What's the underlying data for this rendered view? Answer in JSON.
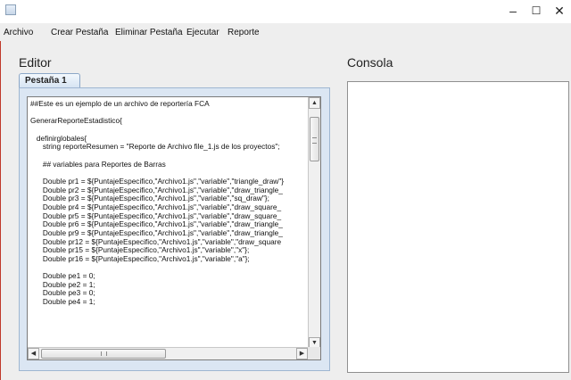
{
  "window": {
    "minimize_glyph": "–",
    "maximize_glyph": "☐",
    "close_glyph": "✕"
  },
  "menu": {
    "items": [
      "Archivo",
      "Crear Pestaña",
      "Eliminar Pestaña",
      "Ejecutar",
      "Reporte"
    ]
  },
  "editor": {
    "title": "Editor",
    "tabs": [
      {
        "label": "Pestaña 1",
        "selected": true
      }
    ],
    "lines": [
      "##Este es un ejemplo de un archivo de reportería FCA",
      "",
      "GenerarReporteEstadistico{",
      "",
      "   definirglobales{",
      "      string reporteResumen = \"Reporte de Archivo file_1.js de los proyectos\";",
      "",
      "      ## variables para Reportes de Barras",
      "",
      "      Double pr1 = ${PuntajeEspecifico,\"Archivo1.js\",\"variable\",\"triangle_draw\"}",
      "      Double pr2 = ${PuntajeEspecifico,\"Archivo1.js\",\"variable\",\"draw_triangle_",
      "      Double pr3 = ${PuntajeEspecifico,\"Archivo1.js\",\"variable\",\"sq_draw\"};",
      "      Double pr4 = ${PuntajeEspecifico,\"Archivo1.js\",\"variable\",\"draw_square_",
      "      Double pr5 = ${PuntajeEspecifico,\"Archivo1.js\",\"variable\",\"draw_square_",
      "      Double pr6 = ${PuntajeEspecifico,\"Archivo1.js\",\"variable\",\"draw_triangle_",
      "      Double pr9 = ${PuntajeEspecifico,\"Archivo1.js\",\"variable\",\"draw_triangle_",
      "      Double pr12 = ${PuntajeEspecifico,\"Archivo1.js\",\"variable\",\"draw_square",
      "      Double pr15 = ${PuntajeEspecifico,\"Archivo1.js\",\"variable\",\"x\"};",
      "      Double pr16 = ${PuntajeEspecifico,\"Archivo1.js\",\"variable\",\"a\"};",
      "",
      "      Double pe1 = 0;",
      "      Double pe2 = 1;",
      "      Double pe3 = 0;",
      "      Double pe4 = 1;"
    ]
  },
  "console": {
    "title": "Consola",
    "content": ""
  },
  "scrollbars": {
    "up_arrow": "▲",
    "down_arrow": "▼",
    "left_arrow": "◀",
    "right_arrow": "▶"
  }
}
